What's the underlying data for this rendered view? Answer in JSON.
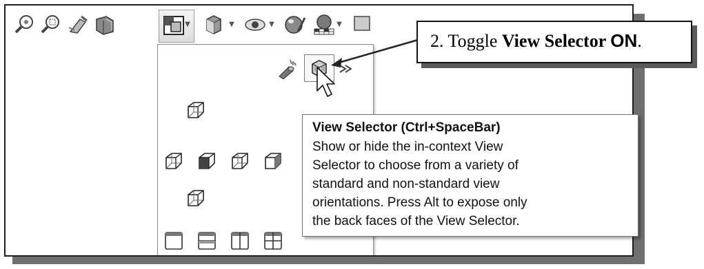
{
  "callout": {
    "number": "2. ",
    "text": "Toggle ",
    "bold": "View Selector ",
    "on": "ON",
    "period": "."
  },
  "tooltip": {
    "title": "View Selector  (Ctrl+SpaceBar)",
    "lines": [
      "Show or hide the in-context View",
      "Selector to choose from a variety of",
      "standard and non-standard view",
      "orientations. Press Alt to expose only",
      "the back faces of the View Selector."
    ]
  },
  "toolbar": {
    "icons": [
      "zoom-to-fit-icon",
      "zoom-to-area-icon",
      "previous-view-icon",
      "section-view-icon",
      "view-orientation-icon",
      "display-style-icon",
      "hide-show-items-icon",
      "edit-appearance-icon",
      "apply-scene-icon",
      "view-settings-icon"
    ]
  },
  "dropdown": {
    "icons": [
      "normal-to-icon",
      "view-selector-icon",
      "more-arrows-icon",
      "top-view-icon",
      "left-view-icon",
      "front-view-icon",
      "right-view-icon",
      "back-view-icon",
      "bottom-view-icon",
      "single-view-icon",
      "two-view-horizontal-icon",
      "two-view-vertical-icon",
      "four-view-icon"
    ]
  }
}
